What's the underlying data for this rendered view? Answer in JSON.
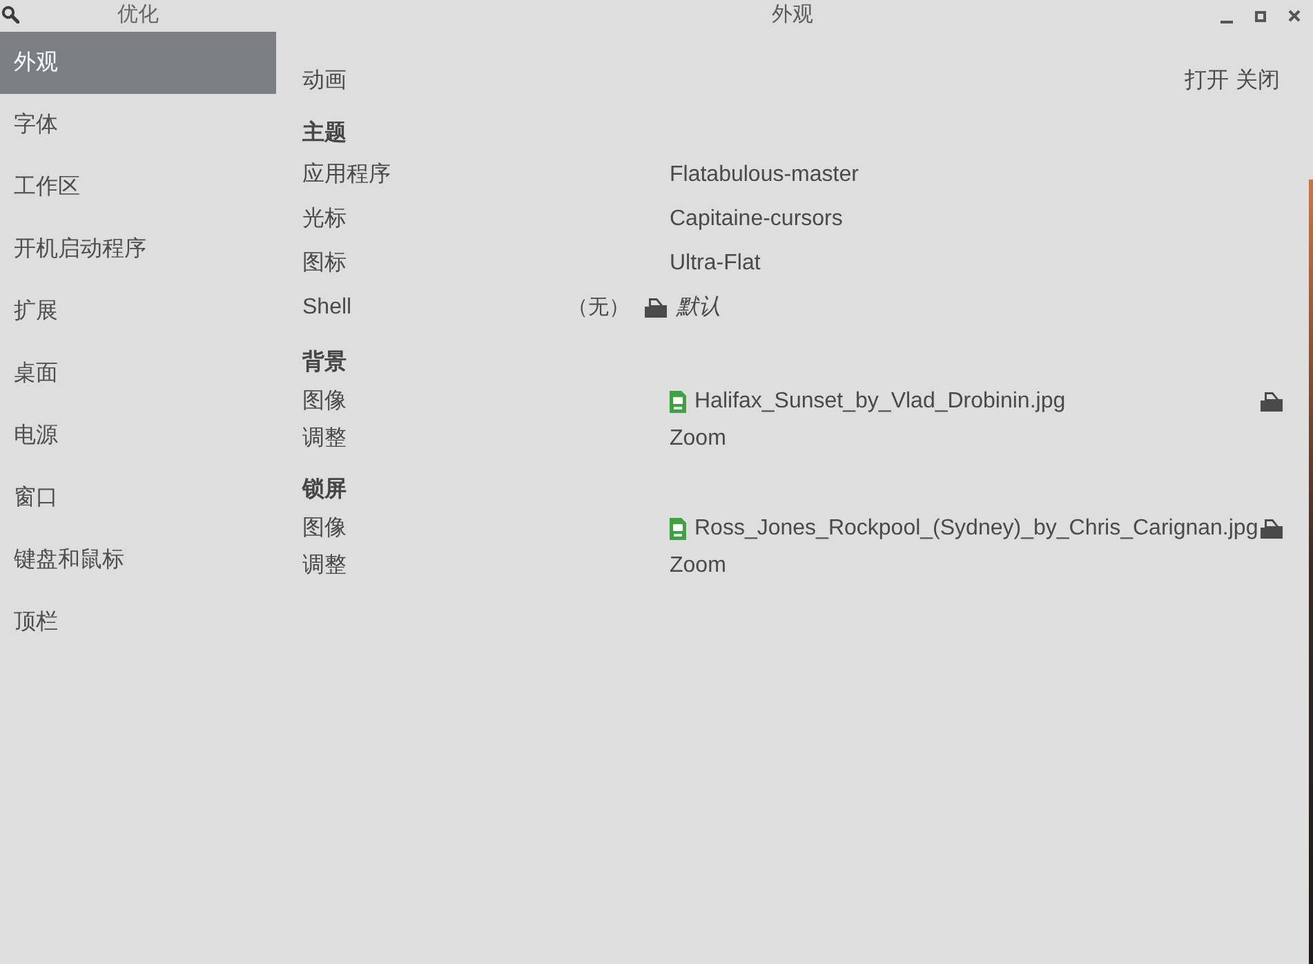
{
  "header": {
    "app_title": "优化",
    "page_title": "外观"
  },
  "sidebar": {
    "items": [
      {
        "label": "外观",
        "selected": true
      },
      {
        "label": "字体",
        "selected": false
      },
      {
        "label": "工作区",
        "selected": false
      },
      {
        "label": "开机启动程序",
        "selected": false
      },
      {
        "label": "扩展",
        "selected": false
      },
      {
        "label": "桌面",
        "selected": false
      },
      {
        "label": "电源",
        "selected": false
      },
      {
        "label": "窗口",
        "selected": false
      },
      {
        "label": "键盘和鼠标",
        "selected": false
      },
      {
        "label": "顶栏",
        "selected": false
      }
    ]
  },
  "animation": {
    "label": "动画",
    "options": [
      "打开",
      "关闭"
    ]
  },
  "sections": [
    {
      "title": "主题",
      "rows": [
        {
          "kind": "value",
          "label": "应用程序",
          "value": "Flatabulous-master"
        },
        {
          "kind": "value",
          "label": "光标",
          "value": "Capitaine-cursors"
        },
        {
          "kind": "value",
          "label": "图标",
          "value": "Ultra-Flat"
        },
        {
          "kind": "shell",
          "label": "Shell",
          "note": "（无）",
          "value": "默认"
        }
      ]
    },
    {
      "title": "背景",
      "rows": [
        {
          "kind": "file",
          "label": "图像",
          "value": "Halifax_Sunset_by_Vlad_Drobinin.jpg"
        },
        {
          "kind": "value",
          "label": "调整",
          "value": "Zoom"
        }
      ]
    },
    {
      "title": "锁屏",
      "rows": [
        {
          "kind": "file",
          "label": "图像",
          "value": "Ross_Jones_Rockpool_(Sydney)_by_Chris_Carignan.jpg"
        },
        {
          "kind": "value",
          "label": "调整",
          "value": "Zoom"
        }
      ]
    }
  ]
}
